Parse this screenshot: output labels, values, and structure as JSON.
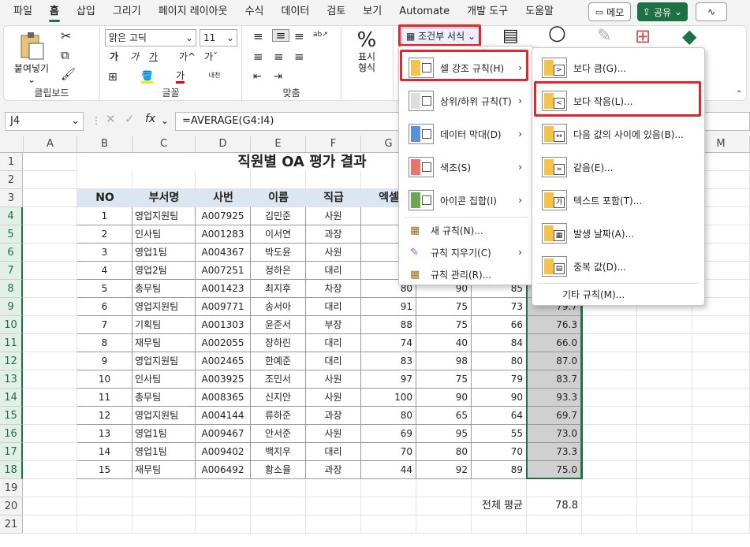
{
  "tabs": [
    "파일",
    "홈",
    "삽입",
    "그리기",
    "페이지 레이아웃",
    "수식",
    "데이터",
    "검토",
    "보기",
    "Automate",
    "개발 도구",
    "도움말"
  ],
  "top_buttons": {
    "memo": "메모",
    "share": "공유"
  },
  "ribbon": {
    "clipboard": {
      "paste": "붙여넣기",
      "label": "클립보드"
    },
    "font": {
      "name": "맑은 고딕",
      "size": "11",
      "label": "글꼴",
      "bold": "가",
      "italic": "가",
      "underline": "가",
      "grow": "가^",
      "shrink": "가ˇ",
      "color_a": "가",
      "color_b": "가",
      "phonetic": "내천"
    },
    "align": {
      "label": "맞춤"
    },
    "number": {
      "pct": "%",
      "label_a": "표시",
      "label_b": "형식"
    },
    "cond_format": "조건부 서식"
  },
  "formula_bar": {
    "name_box": "J4",
    "formula": "=AVERAGE(G4:I4)"
  },
  "columns": [
    "A",
    "B",
    "C",
    "D",
    "E",
    "F",
    "G",
    "H",
    "I",
    "J",
    "K",
    "L",
    "M"
  ],
  "rows": [
    "1",
    "2",
    "3",
    "4",
    "5",
    "6",
    "7",
    "8",
    "9",
    "10",
    "11",
    "12",
    "13",
    "14",
    "15",
    "16",
    "17",
    "18",
    "19",
    "20",
    "21"
  ],
  "title": "직원별 OA 평가 결과",
  "table_headers": [
    "NO",
    "부서명",
    "사번",
    "이름",
    "직급",
    "엑셀"
  ],
  "table_rows": [
    {
      "no": "1",
      "dept": "영업지원팀",
      "id": "A007925",
      "name": "김민준",
      "rank": "사원",
      "g": "",
      "h": "",
      "i": "",
      "j": ""
    },
    {
      "no": "2",
      "dept": "인사팀",
      "id": "A001283",
      "name": "이서연",
      "rank": "과장",
      "g": "",
      "h": "",
      "i": "",
      "j": ""
    },
    {
      "no": "3",
      "dept": "영업1팀",
      "id": "A004367",
      "name": "박도윤",
      "rank": "사원",
      "g": "",
      "h": "",
      "i": "",
      "j": ""
    },
    {
      "no": "4",
      "dept": "영업2팀",
      "id": "A007251",
      "name": "정하은",
      "rank": "대리",
      "g": "",
      "h": "",
      "i": "",
      "j": ""
    },
    {
      "no": "5",
      "dept": "총무팀",
      "id": "A001423",
      "name": "최지후",
      "rank": "차장",
      "g": "80",
      "h": "90",
      "i": "85",
      "j": ""
    },
    {
      "no": "6",
      "dept": "영업지원팀",
      "id": "A009771",
      "name": "송서아",
      "rank": "대리",
      "g": "91",
      "h": "75",
      "i": "73",
      "j": "79.7"
    },
    {
      "no": "7",
      "dept": "기획팀",
      "id": "A001303",
      "name": "윤준서",
      "rank": "부장",
      "g": "88",
      "h": "75",
      "i": "66",
      "j": "76.3"
    },
    {
      "no": "8",
      "dept": "재무팀",
      "id": "A002055",
      "name": "장하린",
      "rank": "대리",
      "g": "74",
      "h": "40",
      "i": "84",
      "j": "66.0"
    },
    {
      "no": "9",
      "dept": "영업지원팀",
      "id": "A002465",
      "name": "한예준",
      "rank": "대리",
      "g": "83",
      "h": "98",
      "i": "80",
      "j": "87.0"
    },
    {
      "no": "10",
      "dept": "인사팀",
      "id": "A003925",
      "name": "조민서",
      "rank": "사원",
      "g": "97",
      "h": "75",
      "i": "79",
      "j": "83.7"
    },
    {
      "no": "11",
      "dept": "총무팀",
      "id": "A008365",
      "name": "신지안",
      "rank": "사원",
      "g": "100",
      "h": "90",
      "i": "90",
      "j": "93.3"
    },
    {
      "no": "12",
      "dept": "영업지원팀",
      "id": "A004144",
      "name": "류하준",
      "rank": "과장",
      "g": "80",
      "h": "65",
      "i": "64",
      "j": "69.7"
    },
    {
      "no": "13",
      "dept": "영업1팀",
      "id": "A009467",
      "name": "안서준",
      "rank": "사원",
      "g": "69",
      "h": "95",
      "i": "55",
      "j": "73.0"
    },
    {
      "no": "14",
      "dept": "영업1팀",
      "id": "A009402",
      "name": "백지우",
      "rank": "대리",
      "g": "70",
      "h": "80",
      "i": "70",
      "j": "73.3"
    },
    {
      "no": "15",
      "dept": "재무팀",
      "id": "A006492",
      "name": "황소율",
      "rank": "과장",
      "g": "44",
      "h": "92",
      "i": "89",
      "j": "75.0"
    }
  ],
  "total": {
    "label": "전체 평균",
    "value": "78.8"
  },
  "menu1": {
    "items": [
      {
        "label": "셀 강조 규칙(H)",
        "icon": "highlight-rules-icon"
      },
      {
        "label": "상위/하위 규칙(T)",
        "icon": "top-bottom-icon"
      },
      {
        "label": "데이터 막대(D)",
        "icon": "data-bars-icon"
      },
      {
        "label": "색조(S)",
        "icon": "color-scale-icon"
      },
      {
        "label": "아이콘 집합(I)",
        "icon": "icon-sets-icon"
      }
    ],
    "small": [
      {
        "label": "새 규칙(N)..."
      },
      {
        "label": "규칙 지우기(C)"
      },
      {
        "label": "규칙 관리(R)..."
      }
    ]
  },
  "menu2": {
    "items": [
      {
        "label": "보다 큼(G)...",
        "icon": "greater-than-icon"
      },
      {
        "label": "보다 작음(L)...",
        "icon": "less-than-icon"
      },
      {
        "label": "다음 값의 사이에 있음(B)...",
        "icon": "between-icon"
      },
      {
        "label": "같음(E)...",
        "icon": "equal-icon"
      },
      {
        "label": "텍스트 포함(T)...",
        "icon": "text-contains-icon"
      },
      {
        "label": "발생 날짜(A)...",
        "icon": "date-icon"
      },
      {
        "label": "중복 값(D)...",
        "icon": "duplicate-icon"
      }
    ],
    "other": "기타 규칙(M)..."
  }
}
